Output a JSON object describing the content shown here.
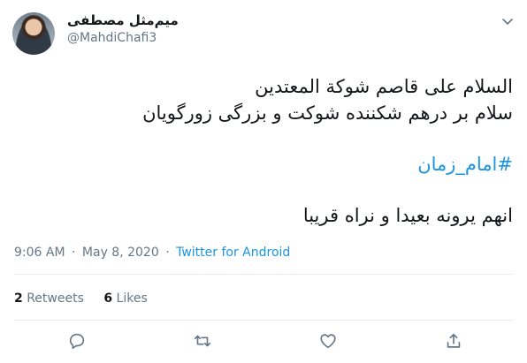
{
  "user": {
    "display_name": "میم‌مثل مصطفی",
    "handle": "@MahdiChafi3"
  },
  "tweet": {
    "lines": [
      "السلام علی قاصم شوکة المعتدین",
      "سلام بر درهم شکننده شوکت و بزرگی زورگویان",
      "#امام_زمان",
      "انهم یرونه بعیدا و نراه قریبا"
    ],
    "time": "9:06 AM",
    "date": "May 8, 2020",
    "separator": "·",
    "source": "Twitter for Android"
  },
  "stats": {
    "retweets_count": "2",
    "retweets_label": "Retweets",
    "likes_count": "6",
    "likes_label": "Likes"
  },
  "colors": {
    "link": "#1b95e0",
    "secondary_text": "#657786",
    "divider": "#e6ecf0"
  },
  "icons": [
    "chevron-down-icon",
    "reply-icon",
    "retweet-icon",
    "like-icon",
    "share-icon"
  ]
}
